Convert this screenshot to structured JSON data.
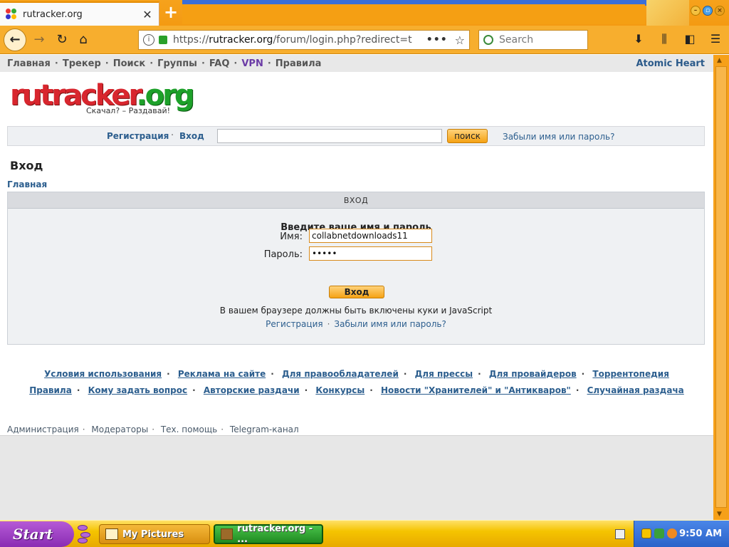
{
  "browser": {
    "tab_title": "rutracker.org",
    "tab_close": "✕",
    "new_tab": "+",
    "url_prefix": "https://",
    "url_host": "rutracker.org",
    "url_path": "/forum/login.php?redirect=t",
    "url_more": "•••",
    "search_placeholder": "Search"
  },
  "topnav": {
    "items": [
      "Главная",
      "Трекер",
      "Поиск",
      "Группы",
      "FAQ",
      "VPN",
      "Правила"
    ],
    "right_link": "Atomic Heart"
  },
  "logo": {
    "text_left": "rutracker",
    "text_right": ".org",
    "slogan": "Скачал? – Раздавай!"
  },
  "searchrow": {
    "register": "Регистрация",
    "login": "Вход",
    "search_button": "поиск",
    "forgot": "Забыли имя или пароль?"
  },
  "page": {
    "title": "Вход",
    "breadcrumb": "Главная"
  },
  "loginbox": {
    "header": "ВХОД",
    "prompt": "Введите ваше имя и пароль",
    "username_label": "Имя:",
    "username_value": "collabnetdownloads11",
    "password_label": "Пароль:",
    "password_value": "•••••",
    "submit": "Вход",
    "note": "В вашем браузере должны быть включены куки и JavaScript",
    "link_register": "Регистрация",
    "link_forgot": "Забыли имя или пароль?"
  },
  "footer": {
    "row1": [
      "Условия использования",
      "Реклама на сайте",
      "Для правообладателей",
      "Для прессы",
      "Для провайдеров",
      "Торрентопедия"
    ],
    "row2": [
      "Правила",
      "Кому задать вопрос",
      "Авторские раздачи",
      "Конкурсы",
      "Новости \"Хранителей\" и \"Антикваров\"",
      "Случайная раздача"
    ],
    "admin": [
      "Администрация",
      "Модераторы",
      "Тех. помощь",
      "Telegram-канал"
    ]
  },
  "taskbar": {
    "start": "Start",
    "tasks": [
      "My Pictures",
      "rutracker.org - ..."
    ],
    "clock": "9:50 AM"
  }
}
